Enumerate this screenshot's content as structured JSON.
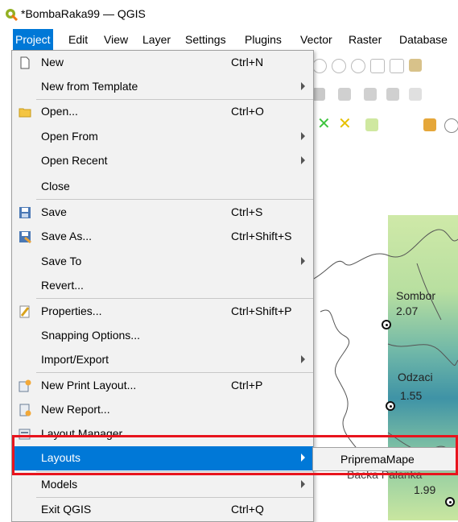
{
  "window": {
    "title": "*BombaRaka99 — QGIS",
    "logo_icon": "qgis-logo-icon"
  },
  "menubar": {
    "items": [
      {
        "label": "Project",
        "active": true
      },
      {
        "label": "Edit"
      },
      {
        "label": "View"
      },
      {
        "label": "Layer"
      },
      {
        "label": "Settings"
      },
      {
        "label": "Plugins"
      },
      {
        "label": "Vector"
      },
      {
        "label": "Raster"
      },
      {
        "label": "Database"
      }
    ]
  },
  "project_menu": {
    "items": [
      {
        "label": "New",
        "shortcut": "Ctrl+N",
        "icon": "new-file-icon"
      },
      {
        "label": "New from Template",
        "submenu": true
      },
      {
        "label": "Open...",
        "shortcut": "Ctrl+O",
        "icon": "folder-open-icon"
      },
      {
        "label": "Open From",
        "submenu": true
      },
      {
        "label": "Open Recent",
        "submenu": true
      },
      {
        "label": "Close"
      },
      {
        "label": "Save",
        "shortcut": "Ctrl+S",
        "icon": "save-icon"
      },
      {
        "label": "Save As...",
        "shortcut": "Ctrl+Shift+S",
        "icon": "save-as-icon"
      },
      {
        "label": "Save To",
        "submenu": true
      },
      {
        "label": "Revert..."
      },
      {
        "label": "Properties...",
        "shortcut": "Ctrl+Shift+P",
        "icon": "properties-icon"
      },
      {
        "label": "Snapping Options..."
      },
      {
        "label": "Import/Export",
        "submenu": true
      },
      {
        "label": "New Print Layout...",
        "shortcut": "Ctrl+P",
        "icon": "new-print-layout-icon"
      },
      {
        "label": "New Report...",
        "icon": "new-report-icon"
      },
      {
        "label": "Layout Manager...",
        "icon": "layout-manager-icon"
      },
      {
        "label": "Layouts",
        "submenu": true,
        "highlighted": true
      },
      {
        "label": "Models",
        "submenu": true
      },
      {
        "label": "Exit QGIS",
        "shortcut": "Ctrl+Q"
      }
    ]
  },
  "submenu": {
    "items": [
      {
        "label": "PripremaMape"
      }
    ]
  },
  "map": {
    "labels": [
      {
        "text": "Sombor"
      },
      {
        "text": "2.07"
      },
      {
        "text": "Odzaci"
      },
      {
        "text": "1.55"
      },
      {
        "text": "Backa Palanka"
      },
      {
        "text": "1.99"
      }
    ]
  },
  "colors": {
    "menu_highlight": "#0078d7",
    "annotation_box": "#e8141d",
    "menu_bg": "#f2f2f2"
  }
}
